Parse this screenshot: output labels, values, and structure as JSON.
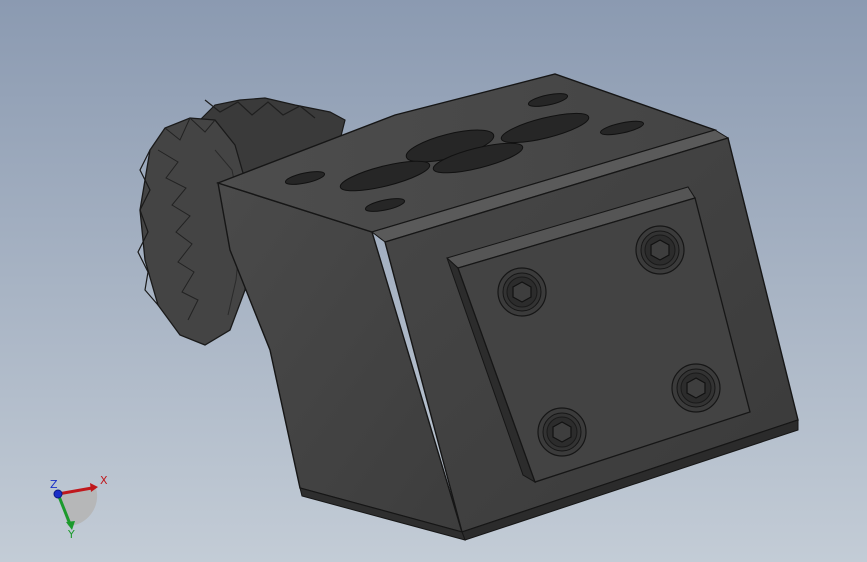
{
  "viewport": {
    "background_top": "#8b9ab1",
    "background_bottom": "#c3ccd6"
  },
  "model": {
    "body_color": "#3c3c3c",
    "edge_color": "#1a1a1a",
    "screw_count": 4,
    "top_hole_count": 8
  },
  "triad": {
    "x_label": "X",
    "y_label": "Y",
    "z_label": "Z",
    "x_color": "#c0181c",
    "y_color": "#1b9a2c",
    "z_color": "#1a2fc8"
  }
}
